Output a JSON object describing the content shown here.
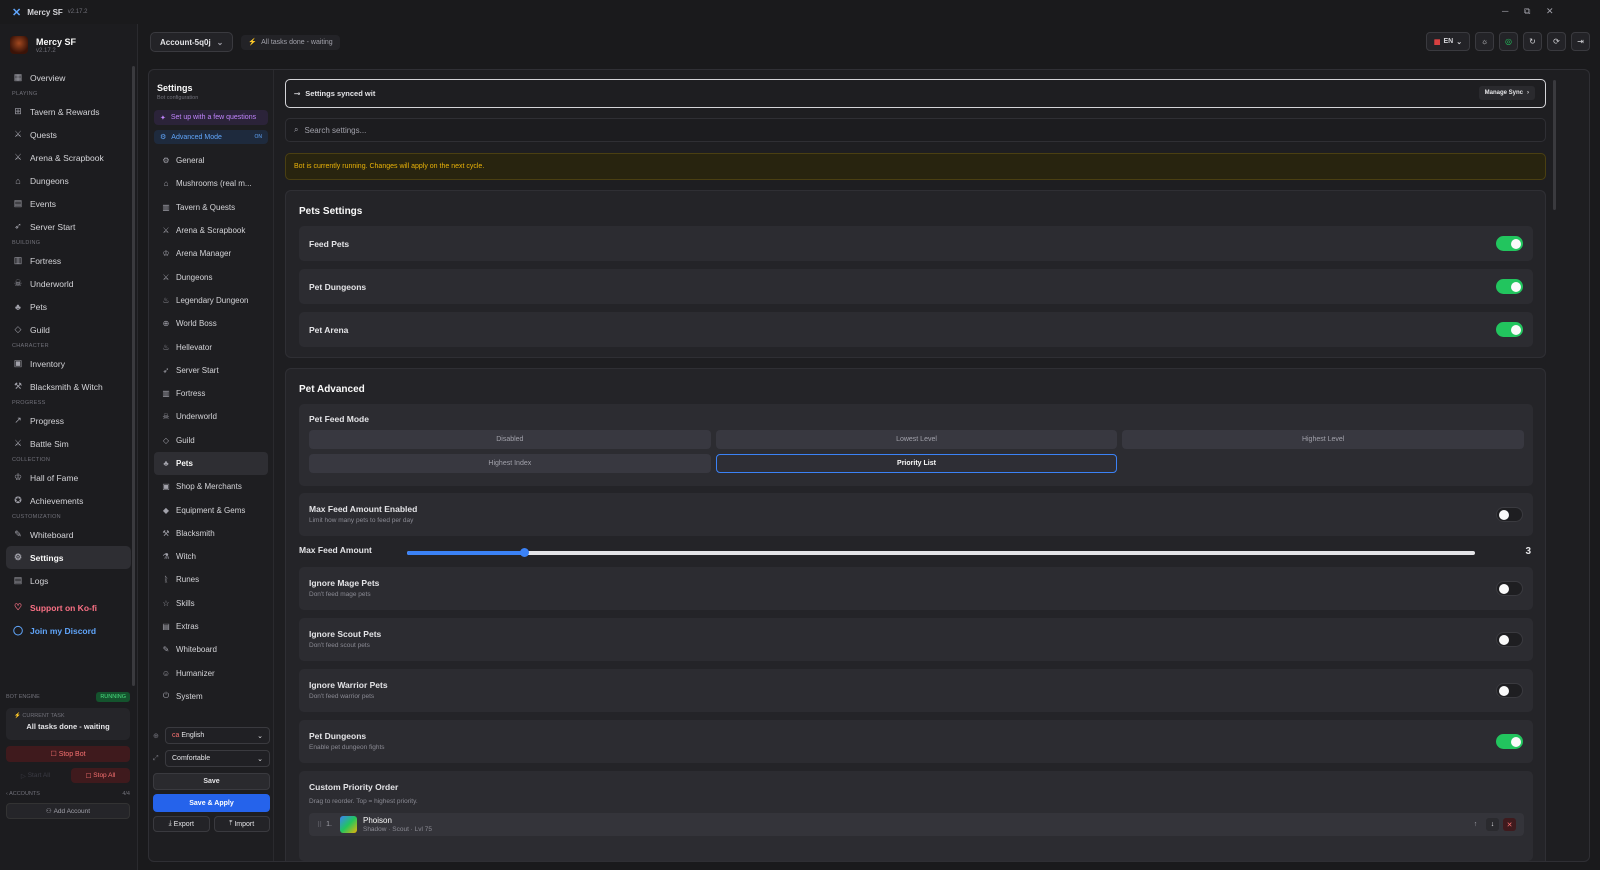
{
  "window": {
    "app_name": "Mercy SF",
    "version": "v2.17.2",
    "minimize": "─",
    "maximize": "⧉",
    "close": "✕"
  },
  "brand": {
    "name": "Mercy SF",
    "version": "v2.17.2"
  },
  "app_nav": {
    "overview": "Overview",
    "sec_playing": "PLAYING",
    "tavern": "Tavern & Rewards",
    "quests": "Quests",
    "arena": "Arena & Scrapbook",
    "dungeons": "Dungeons",
    "events": "Events",
    "server_start": "Server Start",
    "sec_building": "BUILDING",
    "fortress": "Fortress",
    "underworld": "Underworld",
    "pets": "Pets",
    "guild": "Guild",
    "sec_character": "CHARACTER",
    "inventory": "Inventory",
    "blacksmith": "Blacksmith & Witch",
    "sec_progress": "PROGRESS",
    "progress": "Progress",
    "battle_sim": "Battle Sim",
    "sec_collection": "COLLECTION",
    "hall_of_fame": "Hall of Fame",
    "achievements": "Achievements",
    "sec_customization": "CUSTOMIZATION",
    "whiteboard": "Whiteboard",
    "settings": "Settings",
    "logs": "Logs",
    "kofi": "Support on Ko-fi",
    "discord": "Join my Discord"
  },
  "engine": {
    "label": "BOT ENGINE",
    "status": "RUNNING",
    "current_task_label": "CURRENT TASK",
    "current_task": "All tasks done - waiting",
    "stop_bot": "Stop Bot",
    "start_all": "Start All",
    "stop_all": "Stop All",
    "accounts_label": "ACCOUNTS",
    "accounts_count": "4/4",
    "add_account": "Add Account"
  },
  "topbar": {
    "account": "Account-5q0j",
    "status": "All tasks done - waiting",
    "lang": "EN"
  },
  "settings_nav": {
    "title": "Settings",
    "subtitle": "Bot configuration",
    "setup": "Set up with a few questions",
    "advanced": "Advanced Mode",
    "advanced_state": "ON",
    "items": [
      "General",
      "Mushrooms (real m...",
      "Tavern & Quests",
      "Arena & Scrapbook",
      "Arena Manager",
      "Dungeons",
      "Legendary Dungeon",
      "World Boss",
      "Hellevator",
      "Server Start",
      "Fortress",
      "Underworld",
      "Guild",
      "Pets",
      "Shop & Merchants",
      "Equipment & Gems",
      "Blacksmith",
      "Witch",
      "Runes",
      "Skills",
      "Extras",
      "Whiteboard",
      "Humanizer",
      "System"
    ],
    "language": "English",
    "density": "Comfortable",
    "save": "Save",
    "save_apply": "Save & Apply",
    "export": "Export",
    "import": "Import"
  },
  "sync": {
    "text": "Settings synced wit",
    "manage": "Manage Sync"
  },
  "search": {
    "placeholder": "Search settings..."
  },
  "warning": "Bot is currently running. Changes will apply on the next cycle.",
  "pets_settings": {
    "title": "Pets Settings",
    "rows": [
      {
        "label": "Feed Pets",
        "on": true
      },
      {
        "label": "Pet Dungeons",
        "on": true
      },
      {
        "label": "Pet Arena",
        "on": true
      }
    ]
  },
  "pet_advanced": {
    "title": "Pet Advanced",
    "feed_mode_label": "Pet Feed Mode",
    "modes": [
      "Disabled",
      "Lowest Level",
      "Highest Level",
      "Highest Index",
      "Priority List"
    ],
    "selected_mode": "Priority List",
    "max_feed_enabled": {
      "label": "Max Feed Amount Enabled",
      "sub": "Limit how many pets to feed per day",
      "on": false
    },
    "max_feed_amount": {
      "label": "Max Feed Amount",
      "value": "3",
      "fraction": 0.11
    },
    "rows": [
      {
        "label": "Ignore Mage Pets",
        "sub": "Don't feed mage pets",
        "on": false
      },
      {
        "label": "Ignore Scout Pets",
        "sub": "Don't feed scout pets",
        "on": false
      },
      {
        "label": "Ignore Warrior Pets",
        "sub": "Don't feed warrior pets",
        "on": false
      },
      {
        "label": "Pet Dungeons",
        "sub": "Enable pet dungeon fights",
        "on": true
      }
    ],
    "priority": {
      "label": "Custom Priority Order",
      "sub": "Drag to reorder. Top = highest priority.",
      "items": [
        {
          "num": "1.",
          "name": "Phoison",
          "detail": "Shadow · Scout · Lvl 75"
        }
      ]
    }
  }
}
